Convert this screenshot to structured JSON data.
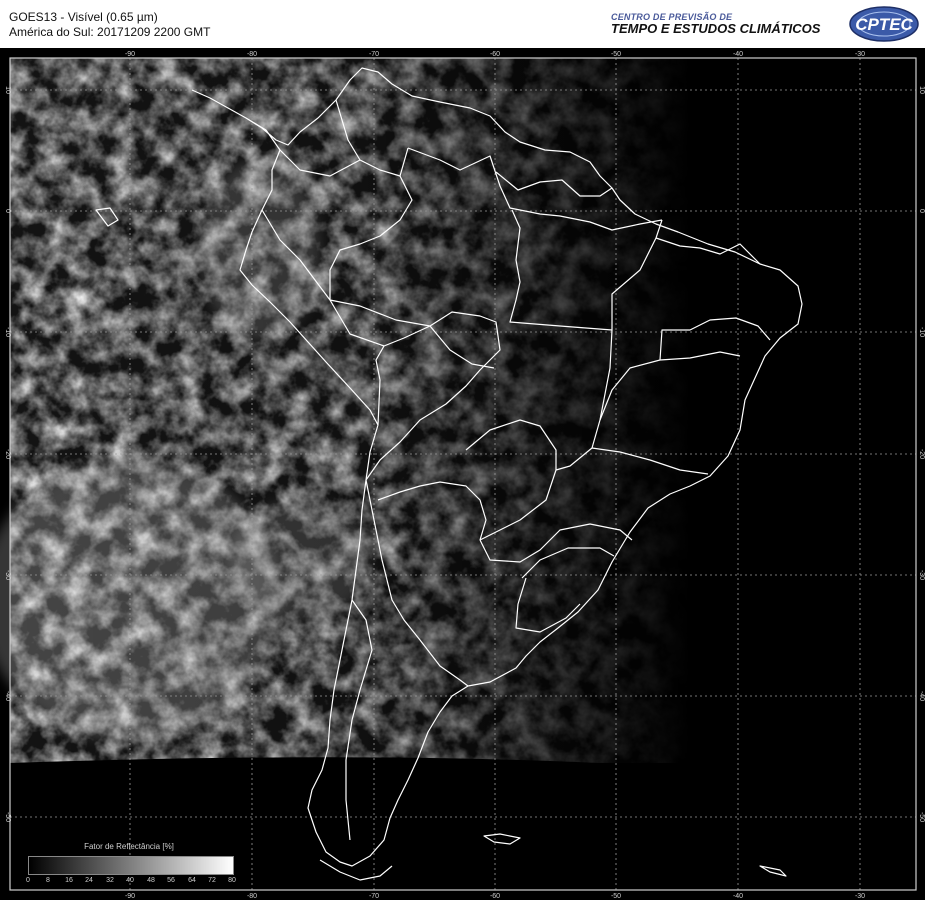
{
  "header": {
    "line1": "GOES13 - Visível (0.65 µm)",
    "line2": "América do Sul: 20171209 2200 GMT",
    "center_small": "CENTRO DE PREVISÃO DE",
    "center_big": "TEMPO E ESTUDOS CLIMÁTICOS",
    "logo_text": "CPTEC"
  },
  "map": {
    "lon_labels_top": [
      "-90",
      "-80",
      "-70",
      "-60",
      "-50",
      "-40",
      "-30"
    ],
    "lon_labels_bottom": [
      "-90",
      "-80",
      "-70",
      "-60",
      "-50",
      "-40",
      "-30"
    ],
    "lat_labels": [
      "10",
      "0",
      "-10",
      "-20",
      "-30",
      "-40",
      "-50"
    ]
  },
  "colorbar": {
    "title": "Fator de Reflectância [%]",
    "ticks": [
      "0",
      "8",
      "16",
      "24",
      "32",
      "40",
      "48",
      "56",
      "64",
      "72",
      "80"
    ]
  }
}
